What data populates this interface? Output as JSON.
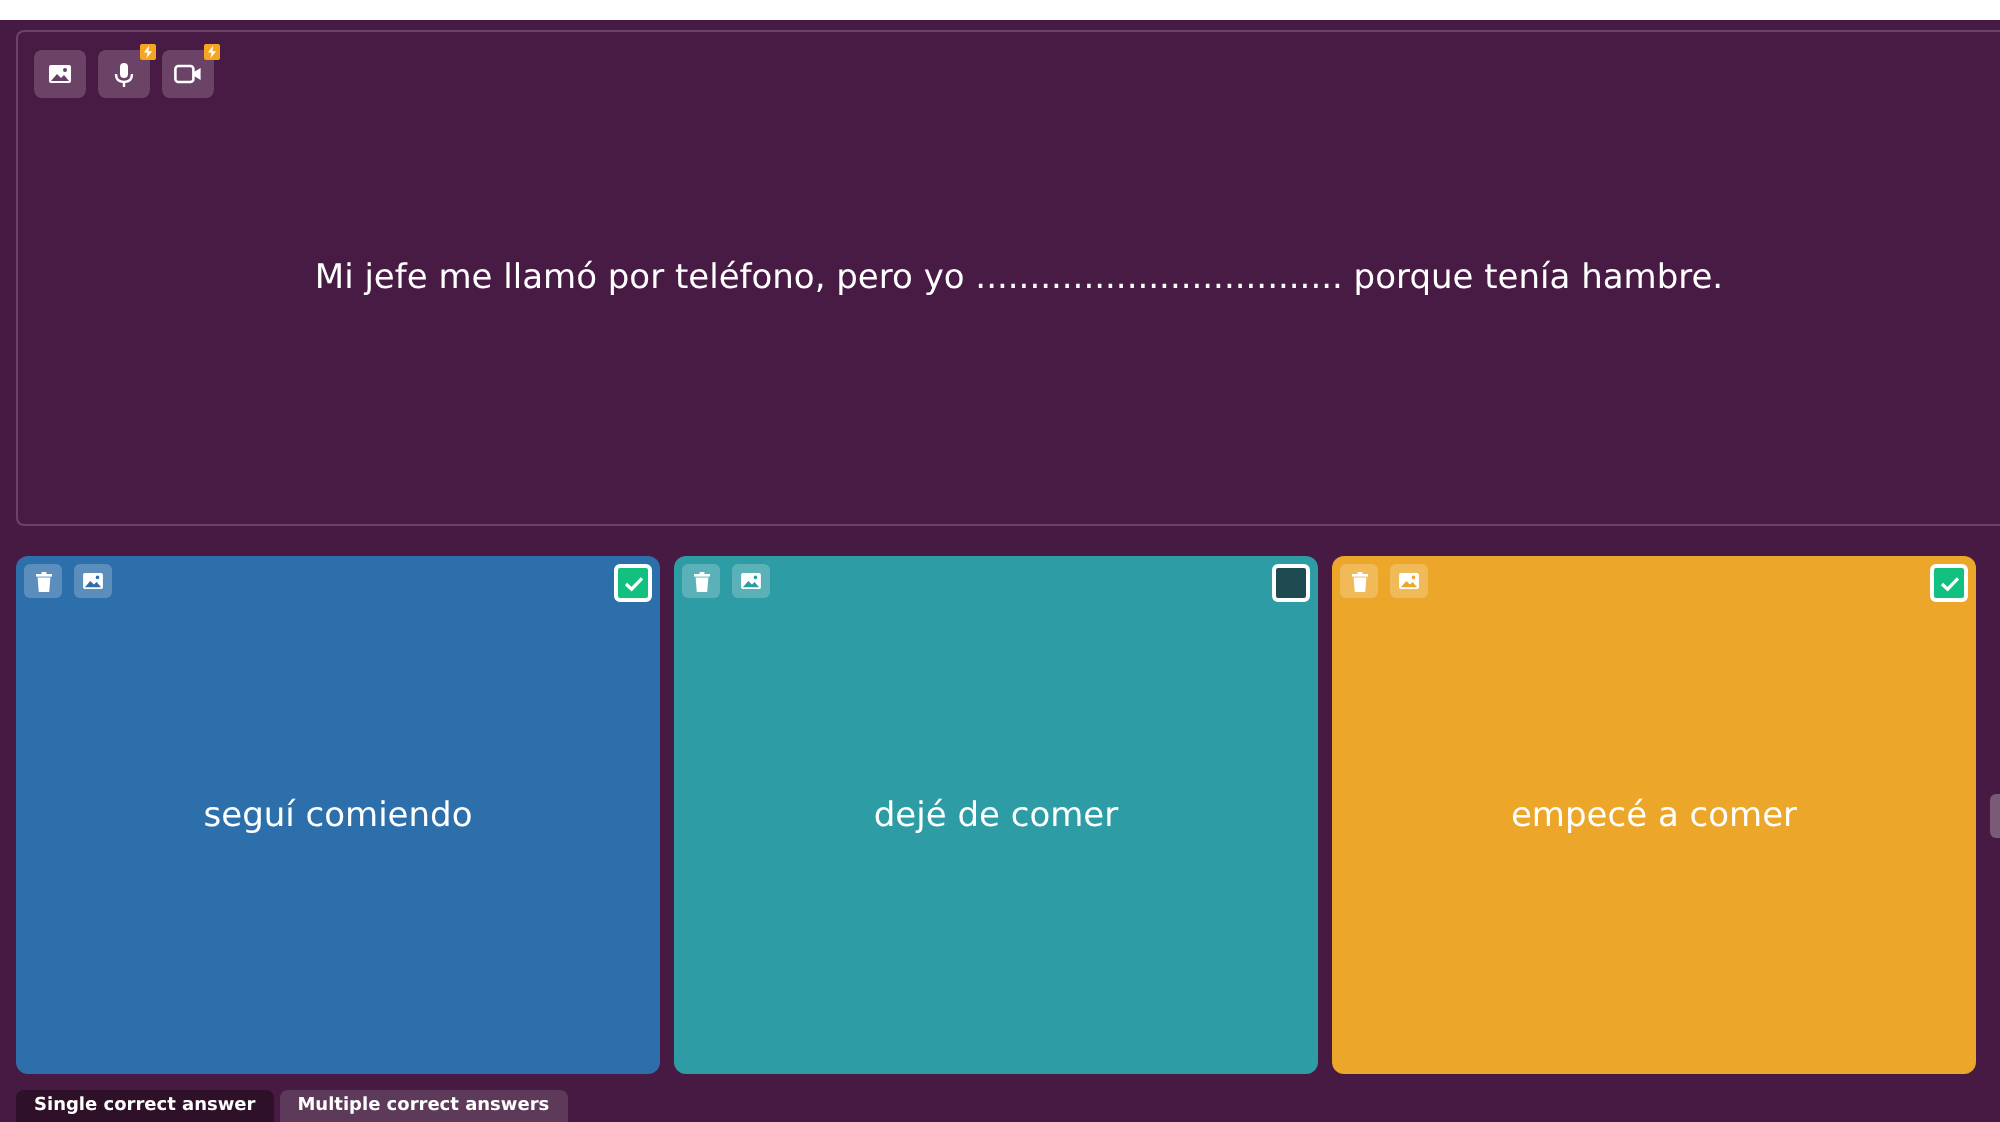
{
  "question": {
    "text": "Mi jefe me llamó por teléfono, pero yo ..................................  porque tenía hambre.",
    "media_buttons": [
      {
        "kind": "image",
        "badge": false
      },
      {
        "kind": "audio",
        "badge": true
      },
      {
        "kind": "video",
        "badge": true
      }
    ]
  },
  "answers": [
    {
      "text": "seguí comiendo",
      "color": "#2d6fab",
      "correct": true
    },
    {
      "text": "dejé de comer",
      "color": "#2d9ca4",
      "correct": false
    },
    {
      "text": "empecé a comer",
      "color": "#eca72b",
      "correct": true
    }
  ],
  "answer_modes": [
    {
      "label": "Single correct answer",
      "selected": false
    },
    {
      "label": "Multiple correct answers",
      "selected": true
    }
  ]
}
